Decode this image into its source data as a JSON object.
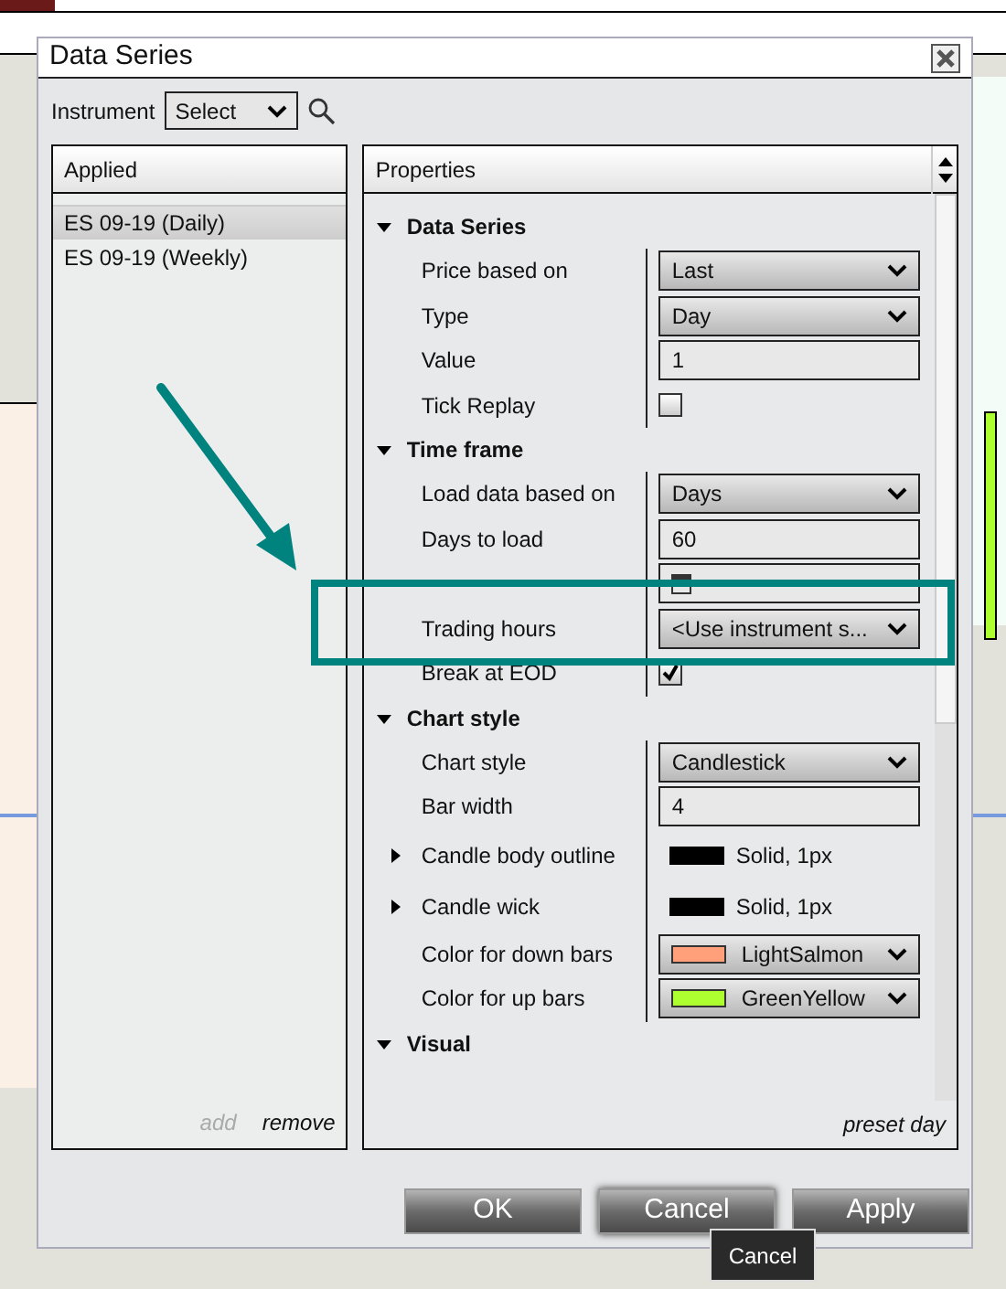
{
  "window": {
    "title": "Data Series"
  },
  "instrument": {
    "label": "Instrument",
    "value": "Select"
  },
  "applied": {
    "header": "Applied",
    "items": [
      {
        "label": "ES 09-19 (Daily)",
        "selected": true
      },
      {
        "label": "ES 09-19 (Weekly)",
        "selected": false
      }
    ],
    "add": "add",
    "remove": "remove"
  },
  "properties": {
    "header": "Properties",
    "footer": "preset day",
    "categories": [
      {
        "title": "Data Series",
        "expanded": true,
        "rows": [
          {
            "kind": "select",
            "label": "Price based on",
            "value": "Last"
          },
          {
            "kind": "select",
            "label": "Type",
            "value": "Day"
          },
          {
            "kind": "text",
            "label": "Value",
            "value": "1"
          },
          {
            "kind": "checkbox",
            "label": "Tick Replay",
            "checked": false
          }
        ]
      },
      {
        "title": "Time frame",
        "expanded": true,
        "rows": [
          {
            "kind": "select",
            "label": "Load data based on",
            "value": "Days"
          },
          {
            "kind": "text",
            "label": "Days to load",
            "value": "60"
          },
          {
            "kind": "date"
          },
          {
            "kind": "select",
            "label": "Trading hours",
            "value": "<Use instrument s..."
          },
          {
            "kind": "checkbox",
            "label": "Break at EOD",
            "checked": true
          }
        ]
      },
      {
        "title": "Chart style",
        "expanded": true,
        "rows": [
          {
            "kind": "select",
            "label": "Chart style",
            "value": "Candlestick"
          },
          {
            "kind": "text",
            "label": "Bar width",
            "value": "4"
          },
          {
            "kind": "stroke",
            "label": "Candle body outline",
            "value": "Solid, 1px",
            "color": "#000000",
            "expanded": false
          },
          {
            "kind": "stroke",
            "label": "Candle wick",
            "value": "Solid, 1px",
            "color": "#000000",
            "expanded": false
          },
          {
            "kind": "color",
            "label": "Color for down bars",
            "value": "LightSalmon",
            "color": "#ffa07a"
          },
          {
            "kind": "color",
            "label": "Color for up bars",
            "value": "GreenYellow",
            "color": "#adff2f"
          }
        ]
      },
      {
        "title": "Visual",
        "expanded": true
      }
    ]
  },
  "buttons": [
    {
      "label": "OK"
    },
    {
      "label": "Cancel"
    },
    {
      "label": "Apply"
    }
  ],
  "tooltip": "Cancel"
}
